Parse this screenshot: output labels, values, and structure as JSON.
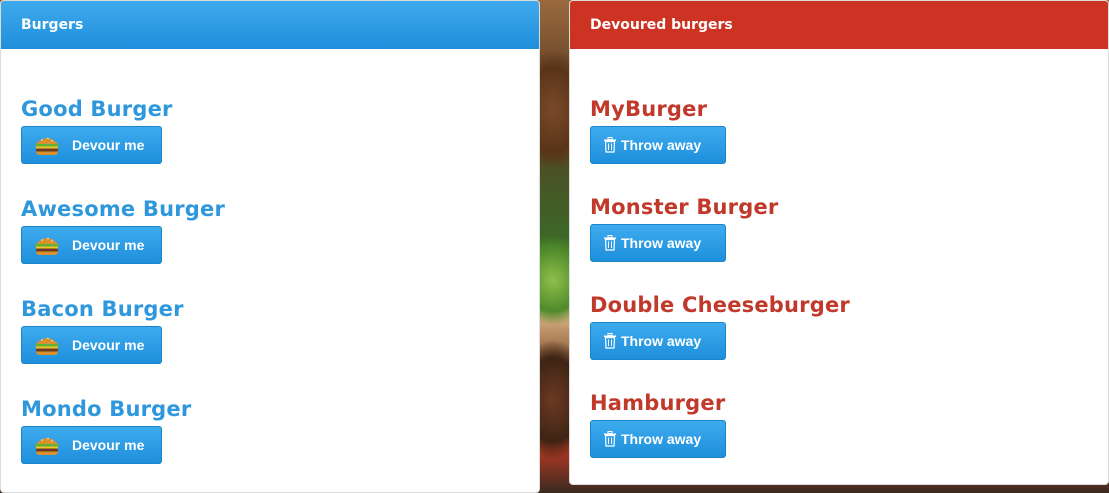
{
  "burgers_panel": {
    "title": "Burgers",
    "items": [
      {
        "name": "Good Burger",
        "button_label": "Devour me"
      },
      {
        "name": "Awesome Burger",
        "button_label": "Devour me"
      },
      {
        "name": "Bacon Burger",
        "button_label": "Devour me"
      },
      {
        "name": "Mondo Burger",
        "button_label": "Devour me"
      }
    ]
  },
  "devoured_panel": {
    "title": "Devoured burgers",
    "items": [
      {
        "name": "MyBurger",
        "button_label": "Throw away"
      },
      {
        "name": "Monster Burger",
        "button_label": "Throw away"
      },
      {
        "name": "Double Cheeseburger",
        "button_label": "Throw away"
      },
      {
        "name": "Hamburger",
        "button_label": "Throw away"
      }
    ]
  },
  "icons": {
    "devour_button_icon": "hamburger-icon",
    "throw_button_icon": "trash-icon"
  },
  "colors": {
    "burgers_heading": "#2b9be6",
    "devoured_heading": "#cc3322",
    "burger_title": "#2f98dc",
    "devoured_title": "#c0392b",
    "button": "#2b9be6"
  }
}
